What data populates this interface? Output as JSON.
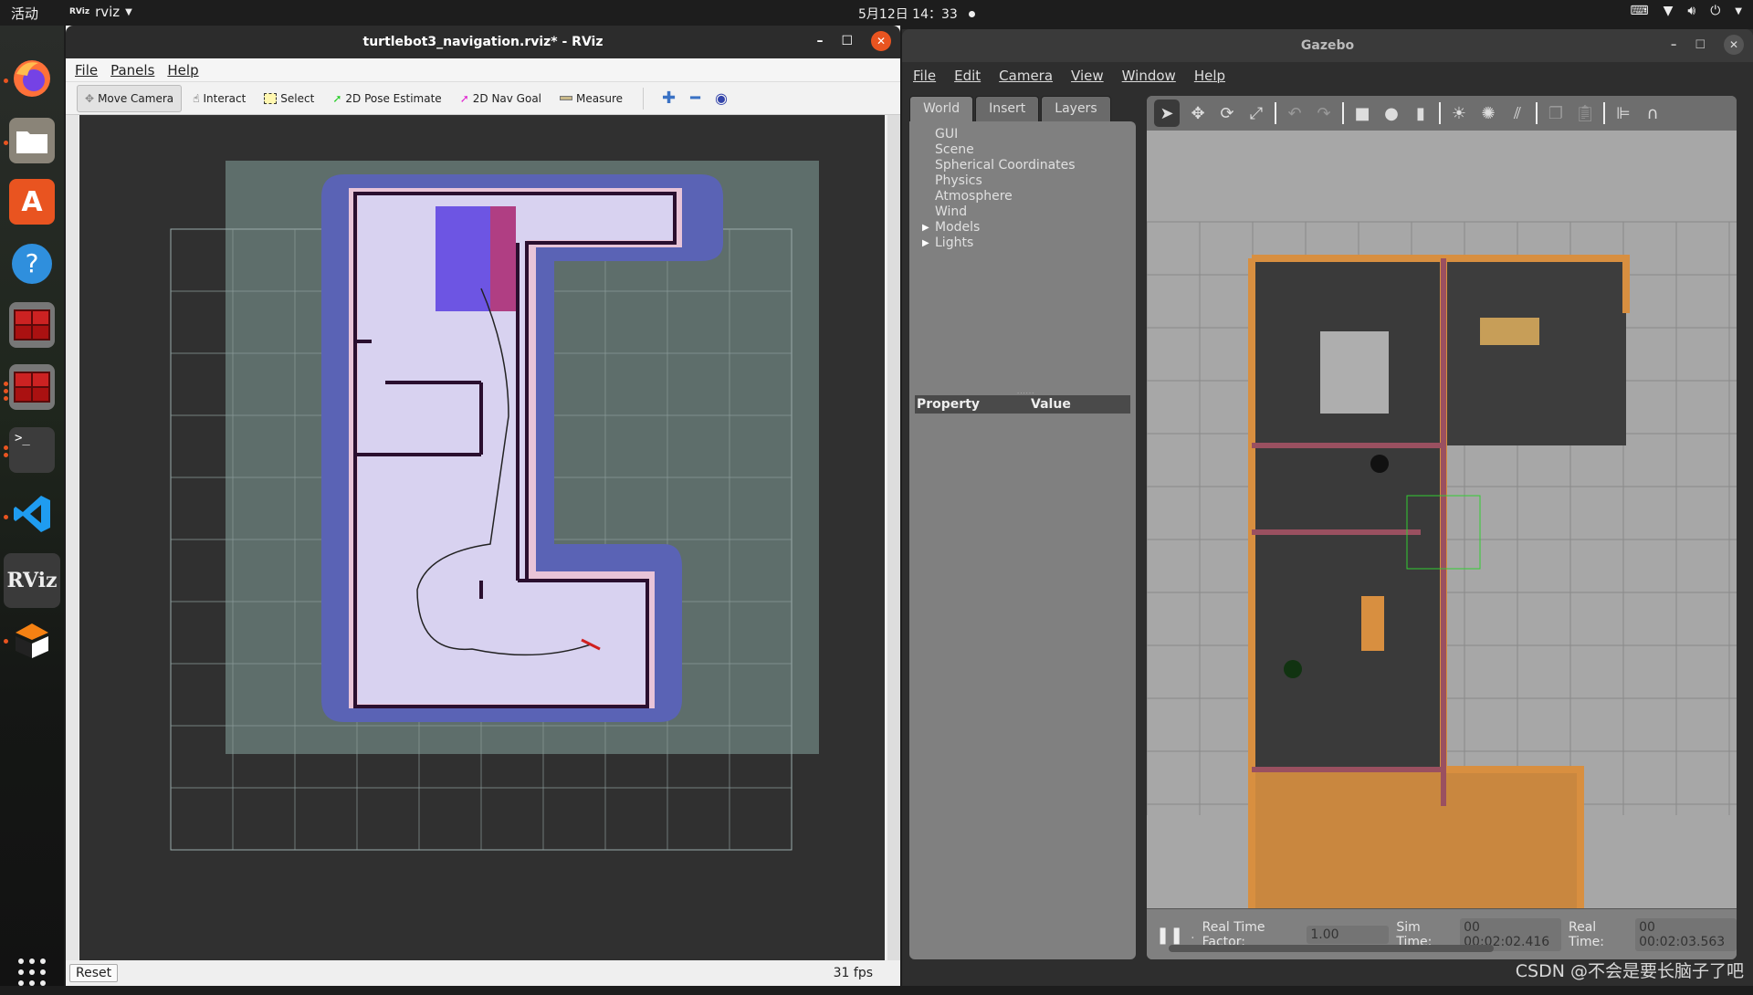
{
  "topbar": {
    "activities": "活动",
    "app_menu_label": "rviz",
    "app_menu_logo": "RViz",
    "datetime": "5月12日 14：33",
    "tray_icons": [
      "keyboard-icon",
      "wifi-icon",
      "volume-icon",
      "power-icon",
      "chevron-down-icon"
    ]
  },
  "dock": {
    "items": [
      {
        "name": "firefox",
        "running": true
      },
      {
        "name": "files",
        "running": true
      },
      {
        "name": "app-center",
        "running": false
      },
      {
        "name": "help",
        "running": false
      },
      {
        "name": "terminator",
        "running": false
      },
      {
        "name": "terminator-2",
        "running": true
      },
      {
        "name": "terminal",
        "running": true
      },
      {
        "name": "vscode",
        "running": true
      },
      {
        "name": "rviz",
        "running": true,
        "label": "RViz"
      },
      {
        "name": "gazebo",
        "running": true
      }
    ],
    "show_apps_icon": "grid-icon"
  },
  "rviz": {
    "title": "turtlebot3_navigation.rviz* - RViz",
    "menu": [
      "File",
      "Panels",
      "Help"
    ],
    "toolbar": [
      {
        "label": "Move Camera",
        "icon": "move-camera-icon",
        "active": true
      },
      {
        "label": "Interact",
        "icon": "hand-icon",
        "active": false
      },
      {
        "label": "Select",
        "icon": "select-box-icon",
        "active": false
      },
      {
        "label": "2D Pose Estimate",
        "icon": "green-arrow-icon",
        "active": false
      },
      {
        "label": "2D Nav Goal",
        "icon": "magenta-arrow-icon",
        "active": false
      },
      {
        "label": "Measure",
        "icon": "ruler-icon",
        "active": false
      }
    ],
    "reset_label": "Reset",
    "fps": "31 fps",
    "colors": {
      "costmap_blue": "#5a63b5",
      "costmap_pink": "#e6c9dd",
      "free": "#d8d2f0",
      "walls": "#2a0f2f",
      "grid_bg": "#5e6e6b",
      "viewport": "#303030"
    }
  },
  "gazebo": {
    "title": "Gazebo",
    "menu": [
      "File",
      "Edit",
      "Camera",
      "View",
      "Window",
      "Help"
    ],
    "tabs": [
      "World",
      "Insert",
      "Layers"
    ],
    "active_tab": "World",
    "tree": [
      {
        "label": "GUI",
        "expandable": false
      },
      {
        "label": "Scene",
        "expandable": false
      },
      {
        "label": "Spherical Coordinates",
        "expandable": false
      },
      {
        "label": "Physics",
        "expandable": false
      },
      {
        "label": "Atmosphere",
        "expandable": false
      },
      {
        "label": "Wind",
        "expandable": false
      },
      {
        "label": "Models",
        "expandable": true
      },
      {
        "label": "Lights",
        "expandable": true
      }
    ],
    "property_header": "Property",
    "value_header": "Value",
    "toolbar_icons": [
      "select-arrow-icon",
      "translate-icon",
      "rotate-icon",
      "scale-icon",
      "undo-icon",
      "redo-icon",
      "box-icon",
      "sphere-icon",
      "cylinder-icon",
      "point-light-icon",
      "spot-light-icon",
      "directional-light-icon",
      "copy-icon",
      "paste-icon",
      "align-icon",
      "snap-icon"
    ],
    "status": {
      "real_time_factor_label": "Real Time Factor:",
      "real_time_factor": "1.00",
      "sim_time_label": "Sim Time:",
      "sim_time": "00 00:02:02.416",
      "real_time_label": "Real Time:",
      "real_time": "00 00:02:03.563"
    }
  },
  "watermark": "CSDN @不会是要长脑子了吧"
}
